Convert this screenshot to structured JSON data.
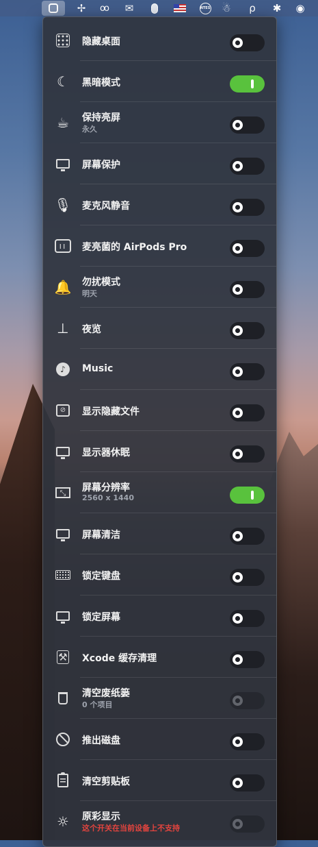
{
  "menubar": {
    "icons": [
      {
        "name": "app-switch-icon",
        "glyph": ""
      },
      {
        "name": "fan-icon",
        "glyph": "✢"
      },
      {
        "name": "glasses-icon",
        "glyph": "oo"
      },
      {
        "name": "wechat-icon",
        "glyph": "✉"
      },
      {
        "name": "mouse-icon",
        "glyph": ""
      },
      {
        "name": "us-flag-icon",
        "glyph": ""
      },
      {
        "name": "ntes-icon",
        "glyph": "NTES"
      },
      {
        "name": "qq-icon",
        "glyph": "☃"
      },
      {
        "name": "p-icon",
        "glyph": "ρ"
      },
      {
        "name": "bluetooth-icon",
        "glyph": "✱"
      },
      {
        "name": "wifi-icon",
        "glyph": "◉"
      }
    ]
  },
  "items": [
    {
      "label": "隐藏桌面",
      "sub": "",
      "state": "off",
      "icon": "desktop-grid-icon"
    },
    {
      "label": "黑暗模式",
      "sub": "",
      "state": "on",
      "icon": "moon-icon"
    },
    {
      "label": "保持亮屏",
      "sub": "永久",
      "state": "off",
      "icon": "coffee-cup-icon"
    },
    {
      "label": "屏幕保护",
      "sub": "",
      "state": "off",
      "icon": "screensaver-icon"
    },
    {
      "label": "麦克风静音",
      "sub": "",
      "state": "off",
      "icon": "microphone-icon"
    },
    {
      "label": "麦亮菌的 AirPods Pro",
      "sub": "",
      "state": "off",
      "icon": "airpods-icon"
    },
    {
      "label": "勿扰模式",
      "sub": "明天",
      "state": "off",
      "icon": "bell-icon"
    },
    {
      "label": "夜览",
      "sub": "",
      "state": "off",
      "icon": "lamp-icon"
    },
    {
      "label": "Music",
      "sub": "",
      "state": "off",
      "icon": "music-icon"
    },
    {
      "label": "显示隐藏文件",
      "sub": "",
      "state": "off",
      "icon": "hidden-file-icon"
    },
    {
      "label": "显示器休眠",
      "sub": "",
      "state": "off",
      "icon": "display-sleep-icon"
    },
    {
      "label": "屏幕分辨率",
      "sub": "2560 x 1440",
      "state": "on",
      "icon": "resolution-icon"
    },
    {
      "label": "屏幕清洁",
      "sub": "",
      "state": "off",
      "icon": "screen-clean-icon"
    },
    {
      "label": "锁定键盘",
      "sub": "",
      "state": "off",
      "icon": "keyboard-lock-icon"
    },
    {
      "label": "锁定屏幕",
      "sub": "",
      "state": "off",
      "icon": "screen-lock-icon"
    },
    {
      "label": "Xcode 缓存清理",
      "sub": "",
      "state": "off",
      "icon": "xcode-icon"
    },
    {
      "label": "清空废纸篓",
      "sub": "0 个项目",
      "state": "disabled",
      "icon": "trash-icon"
    },
    {
      "label": "推出磁盘",
      "sub": "",
      "state": "off",
      "icon": "eject-disk-icon"
    },
    {
      "label": "清空剪贴板",
      "sub": "",
      "state": "off",
      "icon": "clipboard-icon"
    },
    {
      "label": "原彩显示",
      "sub": "这个开关在当前设备上不支持",
      "sub_warn": true,
      "state": "disabled",
      "icon": "true-tone-icon"
    }
  ],
  "colors": {
    "toggle_on": "#59c23d",
    "toggle_off": "#1e2026",
    "warning_text": "#e4443e"
  }
}
